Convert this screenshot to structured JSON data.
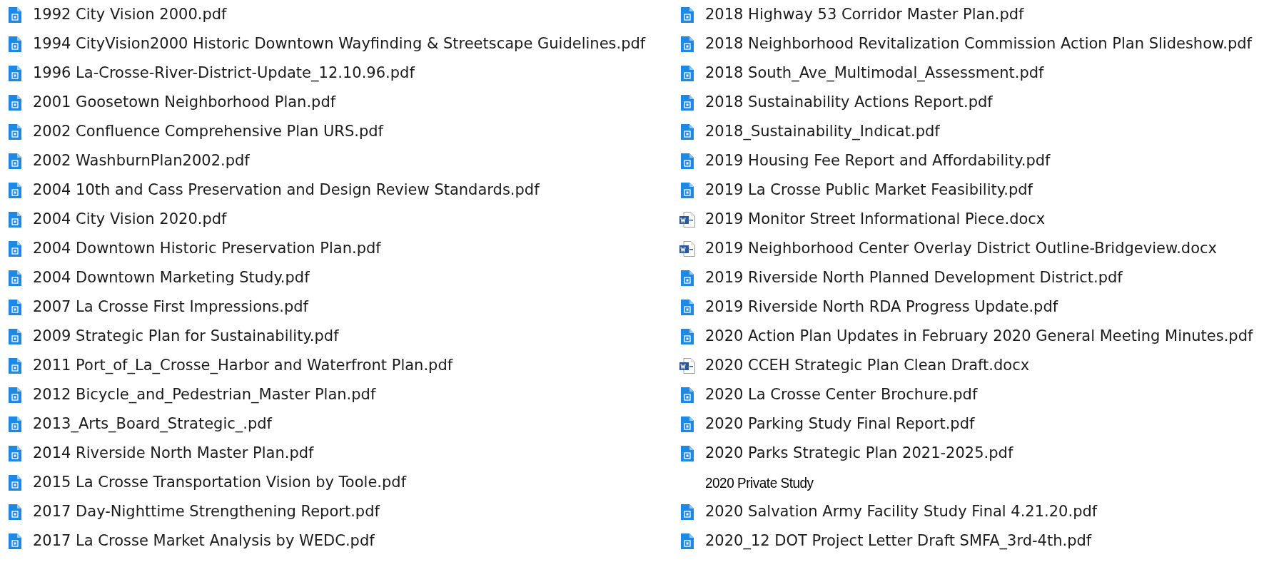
{
  "columns": [
    {
      "files": [
        {
          "kind": "pdf",
          "name": "1992 City Vision 2000.pdf"
        },
        {
          "kind": "pdf",
          "name": "1994 CityVision2000 Historic Downtown Wayfinding & Streetscape Guidelines.pdf"
        },
        {
          "kind": "pdf",
          "name": "1996 La-Crosse-River-District-Update_12.10.96.pdf"
        },
        {
          "kind": "pdf",
          "name": "2001 Goosetown Neighborhood Plan.pdf"
        },
        {
          "kind": "pdf",
          "name": "2002 Confluence Comprehensive Plan URS.pdf"
        },
        {
          "kind": "pdf",
          "name": "2002 WashburnPlan2002.pdf"
        },
        {
          "kind": "pdf",
          "name": "2004 10th and Cass Preservation and Design Review Standards.pdf"
        },
        {
          "kind": "pdf",
          "name": "2004 City Vision 2020.pdf"
        },
        {
          "kind": "pdf",
          "name": "2004 Downtown Historic Preservation Plan.pdf"
        },
        {
          "kind": "pdf",
          "name": "2004 Downtown Marketing Study.pdf"
        },
        {
          "kind": "pdf",
          "name": "2007 La Crosse First Impressions.pdf"
        },
        {
          "kind": "pdf",
          "name": "2009 Strategic Plan for Sustainability.pdf"
        },
        {
          "kind": "pdf",
          "name": "2011 Port_of_La_Crosse_Harbor and Waterfront Plan.pdf"
        },
        {
          "kind": "pdf",
          "name": "2012 Bicycle_and_Pedestrian_Master Plan.pdf"
        },
        {
          "kind": "pdf",
          "name": "2013_Arts_Board_Strategic_.pdf"
        },
        {
          "kind": "pdf",
          "name": "2014 Riverside North Master Plan.pdf"
        },
        {
          "kind": "pdf",
          "name": "2015 La Crosse Transportation Vision by Toole.pdf"
        },
        {
          "kind": "pdf",
          "name": "2017 Day-Nighttime Strengthening Report.pdf"
        },
        {
          "kind": "pdf",
          "name": "2017 La Crosse Market Analysis by WEDC.pdf"
        }
      ]
    },
    {
      "files": [
        {
          "kind": "pdf",
          "name": "2018 Highway 53 Corridor Master Plan.pdf"
        },
        {
          "kind": "pdf",
          "name": "2018 Neighborhood Revitalization Commission Action Plan Slideshow.pdf"
        },
        {
          "kind": "pdf",
          "name": "2018 South_Ave_Multimodal_Assessment.pdf"
        },
        {
          "kind": "pdf",
          "name": "2018 Sustainability Actions Report.pdf"
        },
        {
          "kind": "pdf",
          "name": "2018_Sustainability_Indicat.pdf"
        },
        {
          "kind": "pdf",
          "name": "2019 Housing Fee Report and Affordability.pdf"
        },
        {
          "kind": "pdf",
          "name": "2019 La Crosse Public Market Feasibility.pdf"
        },
        {
          "kind": "docx",
          "name": "2019 Monitor Street Informational Piece.docx"
        },
        {
          "kind": "docx",
          "name": "2019 Neighborhood Center Overlay District Outline-Bridgeview.docx"
        },
        {
          "kind": "pdf",
          "name": "2019 Riverside North Planned Development District.pdf"
        },
        {
          "kind": "pdf",
          "name": "2019 Riverside North RDA Progress Update.pdf"
        },
        {
          "kind": "pdf",
          "name": "2020 Action Plan Updates in February 2020 General Meeting Minutes.pdf"
        },
        {
          "kind": "docx",
          "name": "2020 CCEH Strategic Plan Clean Draft.docx"
        },
        {
          "kind": "pdf",
          "name": "2020 La Crosse Center Brochure.pdf"
        },
        {
          "kind": "pdf",
          "name": "2020 Parking Study Final Report.pdf"
        },
        {
          "kind": "pdf",
          "name": "2020 Parks Strategic Plan 2021-2025.pdf"
        },
        {
          "kind": "label",
          "name": "2020 Private Study"
        },
        {
          "kind": "pdf",
          "name": "2020 Salvation Army Facility Study Final 4.21.20.pdf"
        },
        {
          "kind": "pdf",
          "name": "2020_12 DOT Project Letter Draft SMFA_3rd-4th.pdf"
        }
      ]
    }
  ]
}
